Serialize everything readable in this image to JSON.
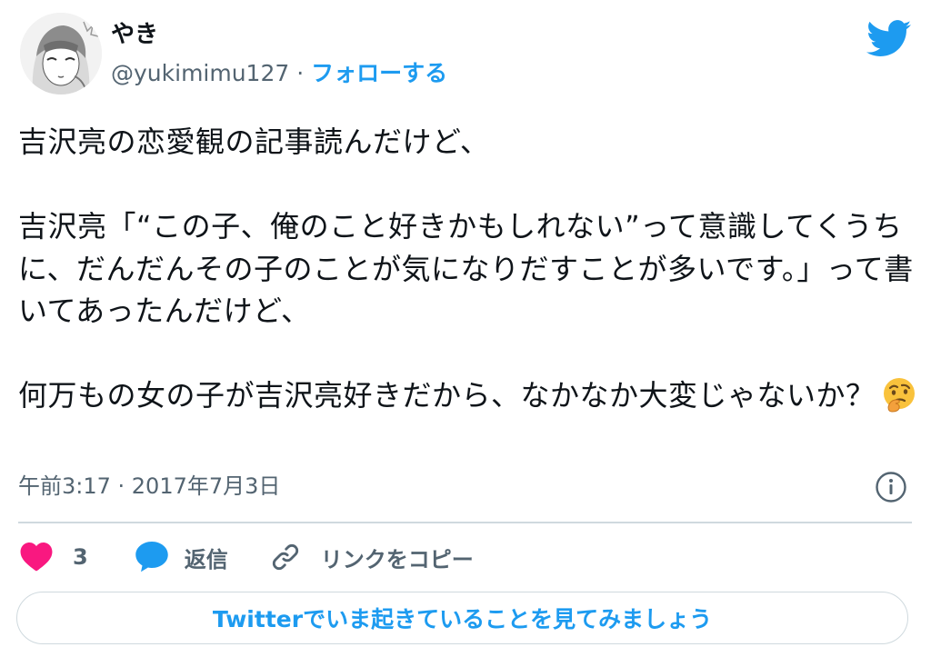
{
  "author": {
    "display_name": "やき",
    "handle": "@yukimimu127",
    "separator": " · ",
    "follow_label": "フォローする"
  },
  "tweet": {
    "text": "吉沢亮の恋愛観の記事読んだけど、\n\n吉沢亮「“この子、俺のこと好きかもしれない”って意識してくうちに、だんだんその子のことが気になりだすことが多いです。」って書いてあったんだけど、\n\n何万もの女の子が吉沢亮好きだから、なかなか大変じゃないか？",
    "emoji": "thinking-face",
    "timestamp": "午前3:17 · 2017年7月3日"
  },
  "actions": {
    "like_count": "3",
    "reply_label": "返信",
    "copy_link_label": "リンクをコピー"
  },
  "cta": {
    "label": "Twitterでいま起きていることを見てみましょう"
  },
  "icons": {
    "brand": "twitter-bird-icon",
    "info": "info-circle-icon",
    "like": "heart-icon",
    "reply": "speech-bubble-icon",
    "copy_link": "link-icon"
  },
  "colors": {
    "accent": "#1d9bf0",
    "like": "#f91880",
    "text": "#0f1419",
    "secondary_text": "#536471",
    "border": "#cfd9de"
  }
}
